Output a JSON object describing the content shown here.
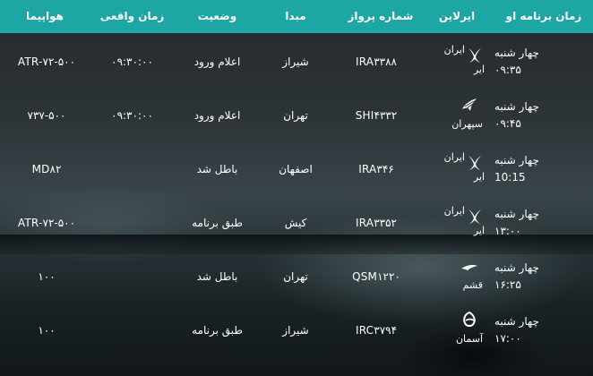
{
  "columns": {
    "time": "زمان برنامه او",
    "airline": "ایرلاین",
    "flight": "شماره پرواز",
    "origin": "مبدا",
    "status": "وضعیت",
    "actual": "زمان واقعی",
    "aircraft": "هواپیما"
  },
  "rows": [
    {
      "day": "چهار شنبه",
      "time": "۰۹:۳۵",
      "airline": "ایران ایر",
      "flight": "IRA۳۳۸۸",
      "origin": "شیراز",
      "status": "اعلام ورود",
      "actual": "۰۹:۳۰:۰۰",
      "aircraft": "ATR-۷۲-۵۰۰"
    },
    {
      "day": "چهار شنبه",
      "time": "۰۹:۴۵",
      "airline": "سپهران",
      "flight": "SHI۴۳۳۲",
      "origin": "تهران",
      "status": "اعلام ورود",
      "actual": "۰۹:۳۰:۰۰",
      "aircraft": "۷۳۷-۵۰۰"
    },
    {
      "day": "چهار شنبه",
      "time": "10:15",
      "airline": "ایران ایر",
      "flight": "IRA۳۴۶",
      "origin": "اصفهان",
      "status": "باطل شد",
      "actual": "",
      "aircraft": "MD۸۲"
    },
    {
      "day": "چهار شنبه",
      "time": "۱۳:۰۰",
      "airline": "ایران ایر",
      "flight": "IRA۳۳۵۲",
      "origin": "کیش",
      "status": "طبق برنامه",
      "actual": "",
      "aircraft": "ATR-۷۲-۵۰۰"
    },
    {
      "day": "چهار شنبه",
      "time": "۱۶:۲۵",
      "airline": "قشم",
      "flight": "QSM۱۲۲۰",
      "origin": "تهران",
      "status": "باطل شد",
      "actual": "",
      "aircraft": "۱۰۰"
    },
    {
      "day": "چهار شنبه",
      "time": "۱۷:۰۰",
      "airline": "آسمان",
      "flight": "IRC۳۷۹۴",
      "origin": "شیراز",
      "status": "طبق برنامه",
      "actual": "",
      "aircraft": "۱۰۰"
    }
  ],
  "airline_icons": [
    "iranair-logo-icon",
    "sepehran-logo-icon",
    "iranair-logo-icon",
    "iranair-logo-icon",
    "qeshm-logo-icon",
    "aseman-logo-icon"
  ],
  "colors": {
    "header": "#1da6a3",
    "text": "#ffffff"
  }
}
